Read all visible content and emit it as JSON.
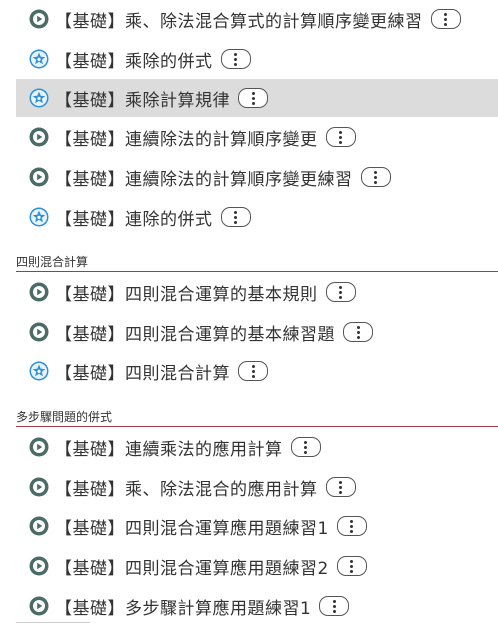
{
  "colors": {
    "play_icon": "#4a6b66",
    "star_icon": "#2f8fd9",
    "section_rule": "#9c3d4a",
    "selected_bg": "#dcdcdc"
  },
  "groups": [
    {
      "header": null,
      "items": [
        {
          "icon": "play-icon",
          "label": "【基礎】乘、除法混合算式的計算順序變更練習",
          "selected": false
        },
        {
          "icon": "star-icon",
          "label": "【基礎】乘除的併式",
          "selected": false
        },
        {
          "icon": "star-icon",
          "label": "【基礎】乘除計算規律",
          "selected": true
        },
        {
          "icon": "play-icon",
          "label": "【基礎】連續除法的計算順序變更",
          "selected": false
        },
        {
          "icon": "play-icon",
          "label": "【基礎】連續除法的計算順序變更練習",
          "selected": false
        },
        {
          "icon": "star-icon",
          "label": "【基礎】連除的併式",
          "selected": false
        }
      ]
    },
    {
      "header": "四則混合計算",
      "items": [
        {
          "icon": "play-icon",
          "label": "【基礎】四則混合運算的基本規則",
          "selected": false
        },
        {
          "icon": "play-icon",
          "label": "【基礎】四則混合運算的基本練習題",
          "selected": false
        },
        {
          "icon": "star-icon",
          "label": "【基礎】四則混合計算",
          "selected": false
        }
      ]
    },
    {
      "header": "多步驟問題的併式",
      "items": [
        {
          "icon": "play-icon",
          "label": "【基礎】連續乘法的應用計算",
          "selected": false
        },
        {
          "icon": "play-icon",
          "label": "【基礎】乘、除法混合的應用計算",
          "selected": false
        },
        {
          "icon": "play-icon",
          "label": "【基礎】四則混合運算應用題練習1",
          "selected": false
        },
        {
          "icon": "play-icon",
          "label": "【基礎】四則混合運算應用題練習2",
          "selected": false
        },
        {
          "icon": "play-icon",
          "label": "【基礎】多步驟計算應用題練習1",
          "selected": false
        }
      ]
    }
  ]
}
